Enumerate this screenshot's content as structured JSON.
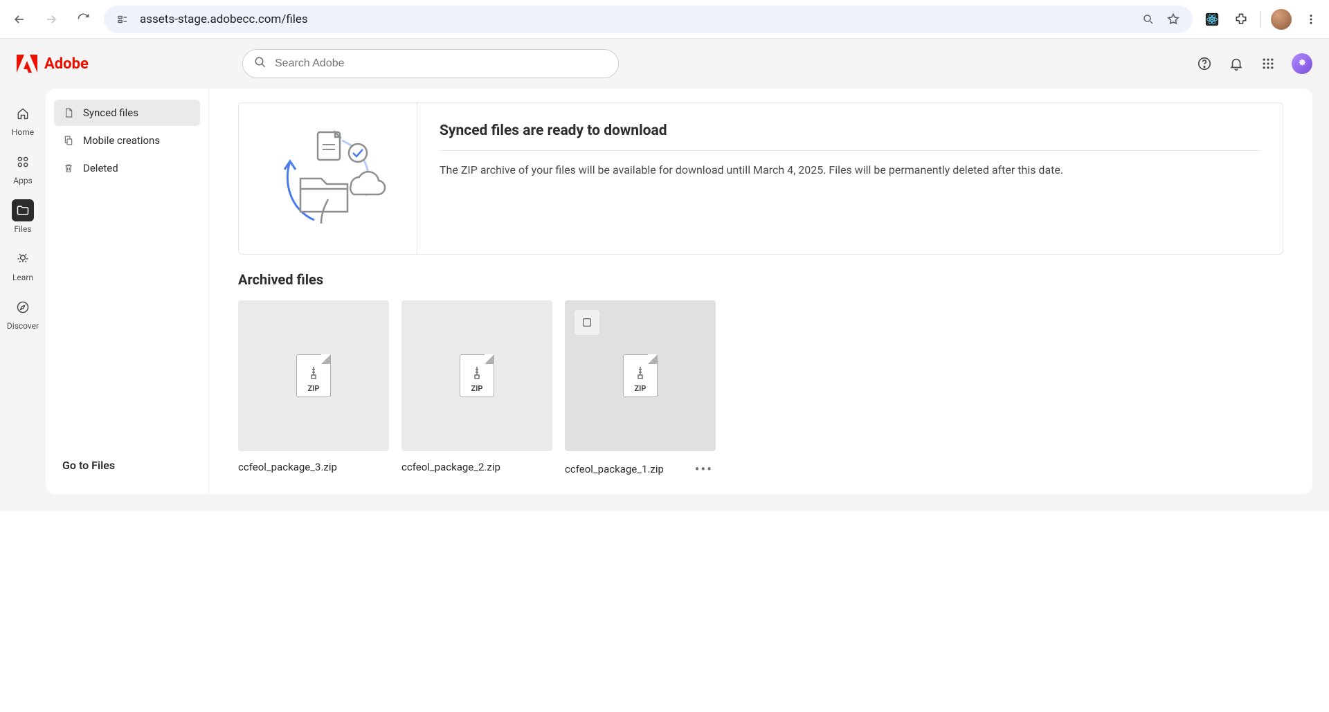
{
  "browser": {
    "url": "assets-stage.adobecc.com/files"
  },
  "brand": "Adobe",
  "search": {
    "placeholder": "Search Adobe"
  },
  "rail": {
    "items": [
      {
        "label": "Home"
      },
      {
        "label": "Apps"
      },
      {
        "label": "Files"
      },
      {
        "label": "Learn"
      },
      {
        "label": "Discover"
      }
    ]
  },
  "sidepanel": {
    "items": [
      {
        "label": "Synced files"
      },
      {
        "label": "Mobile creations"
      },
      {
        "label": "Deleted"
      }
    ],
    "footer": "Go to Files"
  },
  "banner": {
    "title": "Synced files are ready to download",
    "text": "The ZIP archive of your files will be available for download untill March 4, 2025. Files will be permanently deleted after this date."
  },
  "section_title": "Archived files",
  "files": [
    {
      "name": "ccfeol_package_3.zip",
      "type": "ZIP"
    },
    {
      "name": "ccfeol_package_2.zip",
      "type": "ZIP"
    },
    {
      "name": "ccfeol_package_1.zip",
      "type": "ZIP"
    }
  ]
}
